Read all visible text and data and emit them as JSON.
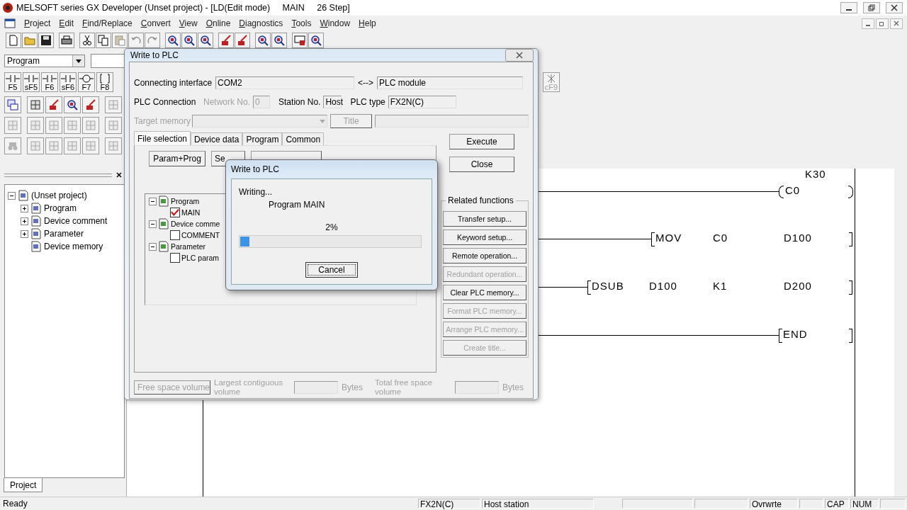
{
  "window": {
    "title": "MELSOFT series GX Developer (Unset project) - [LD(Edit mode)     MAIN     26 Step]"
  },
  "menu": [
    "Project",
    "Edit",
    "Find/Replace",
    "Convert",
    "View",
    "Online",
    "Diagnostics",
    "Tools",
    "Window",
    "Help"
  ],
  "toolbar": [
    {
      "kind": "page",
      "disabled": false
    },
    {
      "kind": "folder",
      "disabled": false
    },
    {
      "kind": "disk",
      "disabled": false
    },
    {
      "kind": "printer",
      "disabled": false
    },
    {
      "kind": "scissors",
      "disabled": false
    },
    {
      "kind": "copy",
      "disabled": false
    },
    {
      "kind": "paste",
      "disabled": true
    },
    {
      "kind": "undo",
      "disabled": true
    },
    {
      "kind": "redo",
      "disabled": true
    },
    {
      "kind": "magnifier",
      "disabled": false
    },
    {
      "kind": "magnifier",
      "disabled": false
    },
    {
      "kind": "magnifier",
      "disabled": false
    },
    {
      "kind": "pencil",
      "disabled": false
    },
    {
      "kind": "pencil",
      "disabled": false
    },
    {
      "kind": "magnifier",
      "disabled": false
    },
    {
      "kind": "magnifier",
      "disabled": false
    },
    {
      "kind": "monitor",
      "disabled": false
    },
    {
      "kind": "magnifier",
      "disabled": false
    }
  ],
  "program_combo": {
    "value": "Program"
  },
  "ladder_keys": [
    {
      "kind": "contact",
      "key": "F5"
    },
    {
      "kind": "contact",
      "key": "sF5"
    },
    {
      "kind": "contact",
      "key": "F6"
    },
    {
      "kind": "contact",
      "key": "sF6"
    },
    {
      "kind": "coil",
      "key": "F7"
    },
    {
      "kind": "instruction",
      "key": "F8"
    }
  ],
  "far_key": {
    "kind": "cross",
    "key": "cF9"
  },
  "tool_rows": [
    [
      {
        "kind": "ladder",
        "disabled": false
      },
      {
        "kind": "grid",
        "disabled": false
      },
      {
        "kind": "pencil",
        "disabled": false
      },
      {
        "kind": "magnifier",
        "disabled": false
      },
      {
        "kind": "pencil",
        "disabled": false
      },
      {
        "kind": "grid",
        "disabled": true
      }
    ],
    [
      {
        "kind": "grid",
        "disabled": true
      },
      {
        "kind": "grid",
        "disabled": true
      },
      {
        "kind": "grid",
        "disabled": true
      },
      {
        "kind": "grid",
        "disabled": true
      },
      {
        "kind": "grid",
        "disabled": true
      },
      {
        "kind": "grid",
        "disabled": true
      }
    ],
    [
      {
        "kind": "binoculars",
        "disabled": true
      },
      {
        "kind": "grid",
        "disabled": true
      },
      {
        "kind": "grid",
        "disabled": true
      },
      {
        "kind": "grid",
        "disabled": true
      },
      {
        "kind": "grid",
        "disabled": true
      },
      {
        "kind": "grid",
        "disabled": true
      }
    ]
  ],
  "project_tree": {
    "label": "(Unset project)",
    "expanded": true,
    "children": [
      {
        "label": "Program",
        "expanded": false
      },
      {
        "label": "Device comment",
        "expanded": false
      },
      {
        "label": "Parameter",
        "expanded": false
      },
      {
        "label": "Device memory"
      }
    ]
  },
  "project_tabs": [
    {
      "label": "Project",
      "selected": true
    }
  ],
  "ladder": [
    {
      "kind": "coil",
      "device": "C0",
      "setting": "K30"
    },
    {
      "kind": "instruction",
      "op": "MOV",
      "operands": [
        "C0",
        "D100"
      ]
    },
    {
      "kind": "instruction",
      "op": "DSUB",
      "operands": [
        "D100",
        "K1",
        "D200"
      ]
    },
    {
      "kind": "end",
      "op": "END"
    }
  ],
  "write_dialog": {
    "title": "Write to PLC",
    "connecting": {
      "label": "Connecting interface",
      "value": "COM2",
      "arrow": "<-->",
      "target": "PLC module"
    },
    "connection": {
      "label": "PLC Connection",
      "network_label": "Network No.",
      "network_value": "0",
      "network_disabled": true,
      "station_label": "Station No.",
      "station_value": "Host",
      "type_label": "PLC type",
      "type_value": "FX2N(C)"
    },
    "target_memory": {
      "label": "Target memory",
      "disabled": true
    },
    "title_button": {
      "label": "Title",
      "disabled": true
    },
    "tabs": [
      {
        "label": "File selection",
        "selected": true
      },
      {
        "label": "Device data",
        "selected": false
      },
      {
        "label": "Program",
        "selected": false
      },
      {
        "label": "Common",
        "selected": false
      }
    ],
    "panel_buttons": [
      "Param+Prog",
      "Se"
    ],
    "file_tree": [
      {
        "label": "Program",
        "expanded": true,
        "children": [
          {
            "label": "MAIN",
            "checked": true
          }
        ]
      },
      {
        "label": "Device comme",
        "expanded": true,
        "children": [
          {
            "label": "COMMENT",
            "checked": false
          }
        ]
      },
      {
        "label": "Parameter",
        "expanded": true,
        "children": [
          {
            "label": "PLC param",
            "checked": false
          }
        ]
      }
    ],
    "execute": "Execute",
    "close": "Close",
    "related": {
      "title": "Related functions",
      "buttons": [
        {
          "label": "Transfer setup...",
          "disabled": false
        },
        {
          "label": "Keyword setup...",
          "disabled": false
        },
        {
          "label": "Remote operation...",
          "disabled": false
        },
        {
          "label": "Redundant operation...",
          "disabled": true
        },
        {
          "label": "Clear PLC memory...",
          "disabled": false
        },
        {
          "label": "Format PLC memory...",
          "disabled": true
        },
        {
          "label": "Arrange PLC memory...",
          "disabled": true
        },
        {
          "label": "Create title...",
          "disabled": true
        }
      ]
    },
    "free_space": {
      "button": "Free space volume",
      "disabled": true,
      "largest_label": "Largest contiguous volume",
      "bytes_1": "Bytes",
      "total_label": "Total free space volume",
      "bytes_2": "Bytes"
    }
  },
  "progress_dialog": {
    "title": "Write to PLC",
    "status": "Writing...",
    "item": "Program  MAIN",
    "percent": "2%",
    "level": 0.05,
    "cancel": "Cancel"
  },
  "status_bar": {
    "message": "Ready",
    "cells": [
      "FX2N(C)",
      "Host station",
      "Ovrwrte",
      "CAP",
      "NUM"
    ]
  }
}
